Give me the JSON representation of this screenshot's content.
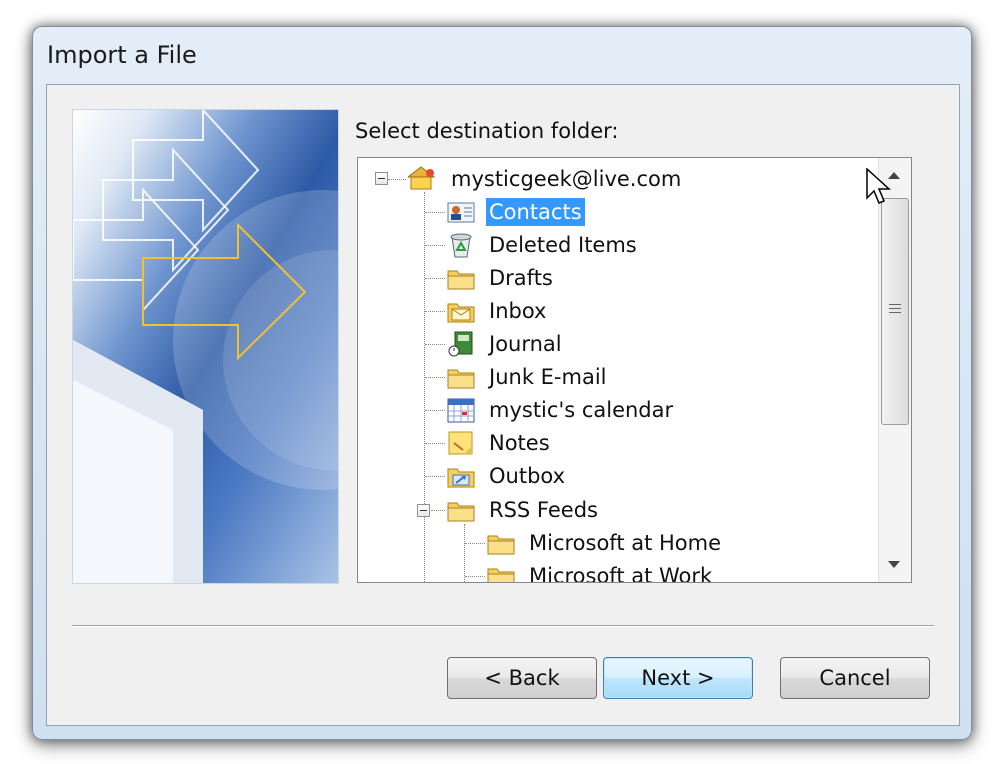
{
  "window": {
    "title": "Import a File"
  },
  "prompt": "Select destination folder:",
  "tree": {
    "root": "mysticgeek@live.com",
    "items": [
      {
        "label": "Contacts",
        "icon": "contacts-icon",
        "selected": true
      },
      {
        "label": "Deleted Items",
        "icon": "deleted-items-icon"
      },
      {
        "label": "Drafts",
        "icon": "folder-icon"
      },
      {
        "label": "Inbox",
        "icon": "inbox-icon"
      },
      {
        "label": "Journal",
        "icon": "journal-icon"
      },
      {
        "label": "Junk E-mail",
        "icon": "folder-icon"
      },
      {
        "label": "mystic's calendar",
        "icon": "calendar-icon"
      },
      {
        "label": "Notes",
        "icon": "notes-icon"
      },
      {
        "label": "Outbox",
        "icon": "outbox-icon"
      },
      {
        "label": "RSS Feeds",
        "icon": "folder-icon",
        "expanded": true
      }
    ],
    "rss_children": [
      {
        "label": "Microsoft at Home",
        "icon": "folder-icon"
      },
      {
        "label": "Microsoft at Work",
        "icon": "folder-icon"
      }
    ]
  },
  "buttons": {
    "back": "< Back",
    "next": "Next >",
    "cancel": "Cancel"
  },
  "colors": {
    "selection": "#3399ff",
    "accent_arrow": "#f2c12e"
  }
}
